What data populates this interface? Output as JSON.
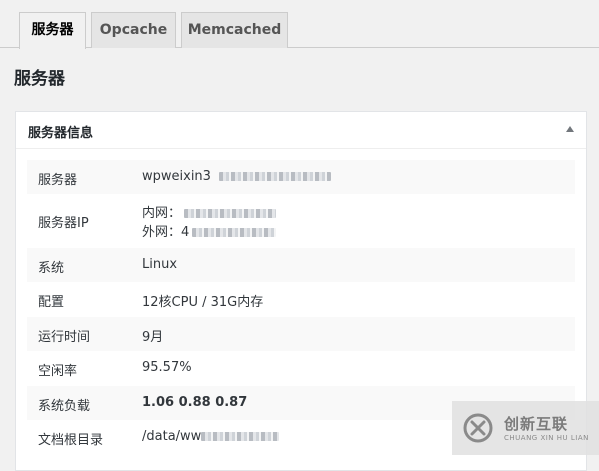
{
  "tabs": [
    {
      "label": "服务器",
      "active": true
    },
    {
      "label": "Opcache",
      "active": false
    },
    {
      "label": "Memcached",
      "active": false
    }
  ],
  "page_title": "服务器",
  "panel": {
    "title": "服务器信息",
    "rows": [
      {
        "label": "服务器",
        "value": "wpweixin3"
      },
      {
        "label": "服务器IP",
        "value_intranet": "内网：",
        "value_extranet": "外网：4"
      },
      {
        "label": "系统",
        "value": "Linux"
      },
      {
        "label": "配置",
        "value": "12核CPU  /  31G内存"
      },
      {
        "label": "运行时间",
        "value": "9月"
      },
      {
        "label": "空闲率",
        "value": "95.57%"
      },
      {
        "label": "系统负载",
        "value": "1.06  0.88  0.87"
      },
      {
        "label": "文档根目录",
        "value": "/data/ww"
      }
    ]
  },
  "watermark": {
    "name_cn": "创新互联",
    "name_en": "CHUANG XIN HU LIAN"
  },
  "icons": {
    "collapse": "triangle-up-icon",
    "brand": "chuangxin-logo-icon"
  }
}
